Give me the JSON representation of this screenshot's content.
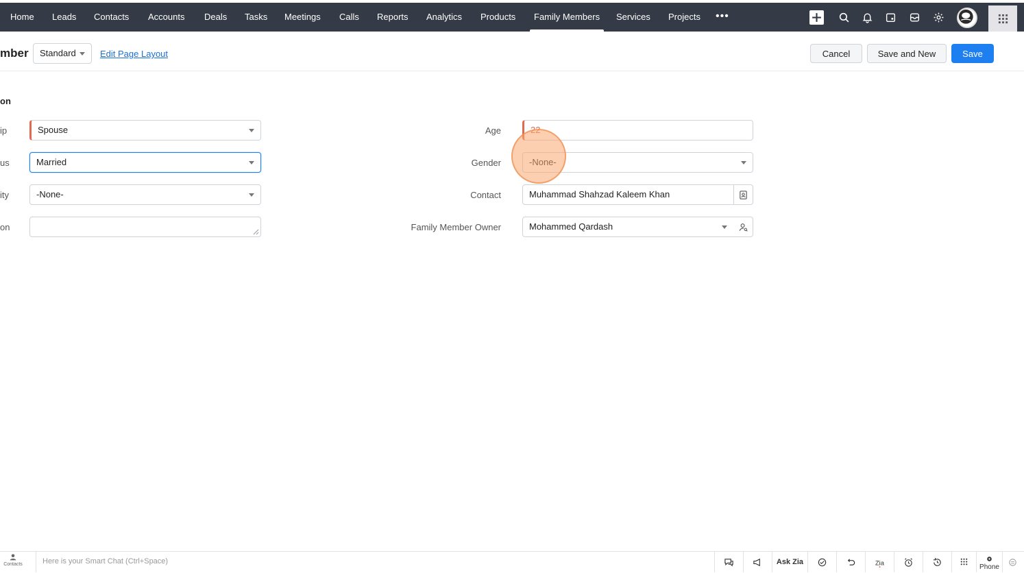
{
  "nav": {
    "tabs": [
      {
        "label": "Home"
      },
      {
        "label": "Leads"
      },
      {
        "label": "Contacts"
      },
      {
        "label": "Accounts"
      },
      {
        "label": "Deals"
      },
      {
        "label": "Tasks"
      },
      {
        "label": "Meetings"
      },
      {
        "label": "Calls"
      },
      {
        "label": "Reports"
      },
      {
        "label": "Analytics"
      },
      {
        "label": "Products"
      },
      {
        "label": "Family Members"
      },
      {
        "label": "Services"
      },
      {
        "label": "Projects"
      }
    ],
    "active_tab": "Family Members",
    "more_label": "•••",
    "icons": [
      "plus-icon",
      "search-icon",
      "bell-icon",
      "calendar-icon",
      "inbox-icon",
      "gear-icon",
      "avatar",
      "apps-grid-icon"
    ]
  },
  "header": {
    "title": "mber",
    "layout_value": "Standard",
    "edit_link": "Edit Page Layout",
    "cancel_label": "Cancel",
    "save_new_label": "Save and New",
    "save_label": "Save"
  },
  "form": {
    "section_title": "on",
    "left": [
      {
        "label": "ip",
        "value": "Spouse"
      },
      {
        "label": "us",
        "value": "Married"
      },
      {
        "label": "ity",
        "value": "-None-"
      },
      {
        "label": "on",
        "value": ""
      }
    ],
    "right": [
      {
        "label": "Age",
        "value": "22"
      },
      {
        "label": "Gender",
        "value": "-None-"
      },
      {
        "label": "Contact",
        "value": "Muhammad Shahzad Kaleem Khan"
      },
      {
        "label": "Family Member Owner",
        "value": "Mohammed Qardash"
      }
    ]
  },
  "bottom": {
    "contacts_label": "Contacts",
    "chat_placeholder": "Here is your Smart Chat (Ctrl+Space)",
    "ask_zia": "Ask Zia",
    "phone_label": "Phone"
  },
  "colors": {
    "nav_bg": "#343a46",
    "primary": "#1d7ff0",
    "mandatory": "#e0694f",
    "click_highlight": "#f9a870"
  }
}
